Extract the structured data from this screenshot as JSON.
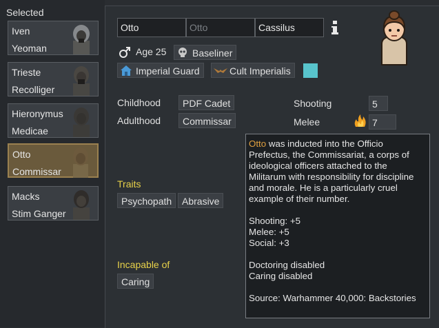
{
  "sidebar": {
    "label": "Selected",
    "pawns": [
      {
        "name": "Iven",
        "title": "Yeoman"
      },
      {
        "name": "Trieste",
        "title": "Recolliger"
      },
      {
        "name": "Hieronymus",
        "title": "Medicae"
      },
      {
        "name": "Otto",
        "title": "Commissar"
      },
      {
        "name": "Macks",
        "title": "Stim Ganger"
      }
    ]
  },
  "name_fields": {
    "first": "Otto",
    "nick_placeholder": "Otto",
    "last": "Cassilus"
  },
  "info_icon": "info-icon",
  "bio": {
    "gender_icon": "male-icon",
    "age": "Age 25",
    "xenotype": "Baseliner",
    "faction": "Imperial Guard",
    "ideology": "Cult Imperialis",
    "favorite_color": "#58c4cc"
  },
  "backstory": {
    "childhood_label": "Childhood",
    "childhood": "PDF Cadet",
    "adulthood_label": "Adulthood",
    "adulthood": "Commissar"
  },
  "skills": [
    {
      "label": "Shooting",
      "value": "5"
    },
    {
      "label": "Melee",
      "value": "7"
    }
  ],
  "traits": {
    "label": "Traits",
    "items": [
      "Psychopath",
      "Abrasive"
    ]
  },
  "incapable": {
    "label": "Incapable of",
    "items": [
      "Caring"
    ]
  },
  "tooltip": {
    "name": "Otto",
    "desc": "was inducted into the Officio Prefectus, the Commissariat, a corps of ideological officers attached to the Militarum with responsibility for discipline and morale. He is a particularly cruel example of their number.",
    "stat1": "Shooting: +5",
    "stat2": "Melee: +5",
    "stat3": "Social: +3",
    "dis1": "Doctoring disabled",
    "dis2": "Caring disabled",
    "source": "Source: Warhammer 40,000: Backstories"
  }
}
